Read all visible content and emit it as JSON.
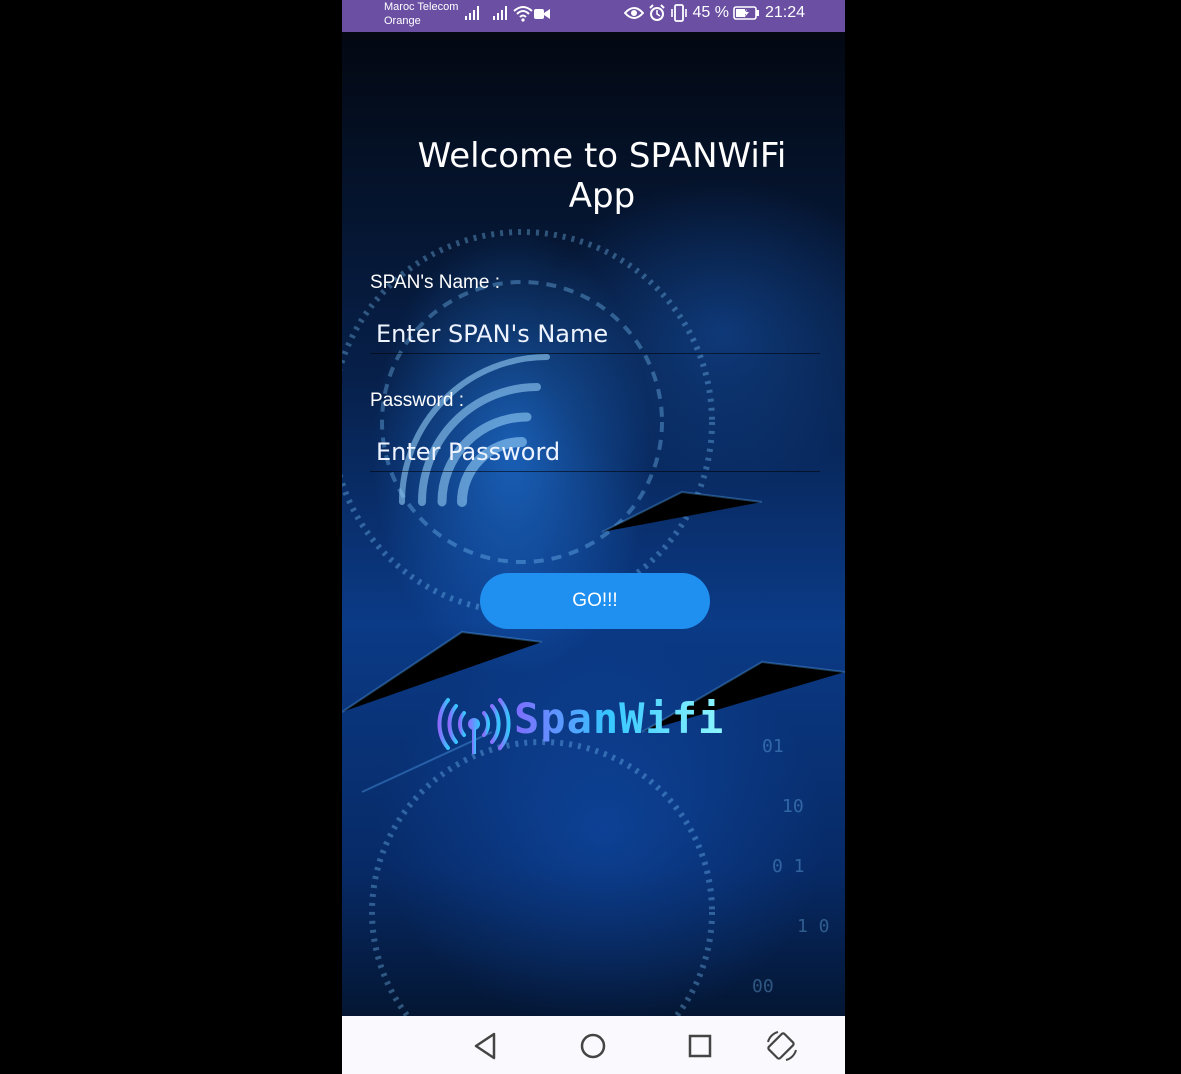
{
  "status_bar": {
    "carrier_1": "Maroc Telecom",
    "carrier_2": "Orange",
    "battery": "45 %",
    "time": "21:24"
  },
  "screen": {
    "title": "Welcome to SPANWiFi App",
    "name_label": "SPAN's Name :",
    "name_placeholder": "Enter SPAN's Name",
    "password_label": "Password :",
    "password_placeholder": "Enter Password",
    "go_label": "GO!!!",
    "logo_text": "SpanWifi"
  },
  "icons": [
    "signal-icon",
    "wifi-icon",
    "camera-icon",
    "eye-icon",
    "alarm-icon",
    "vibrate-icon",
    "battery-icon",
    "back-icon",
    "home-icon",
    "recents-icon",
    "rotate-icon"
  ],
  "colors": {
    "status_bar": "#6a4fa3",
    "button": "#1f8ff0",
    "nav_bar": "#faf9fd"
  }
}
